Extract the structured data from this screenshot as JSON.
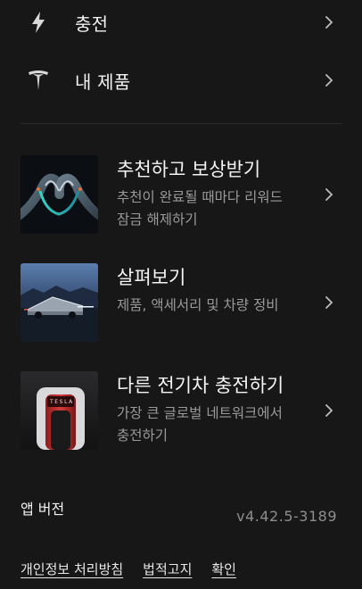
{
  "menu": {
    "charging": {
      "label": "충전",
      "icon": "lightning-bolt-icon"
    },
    "products": {
      "label": "내 제품",
      "icon": "tesla-logo-icon"
    }
  },
  "cards": [
    {
      "title": "추천하고 보상받기",
      "description": "추천이 완료될 때마다 리워드 잠금 해제하기",
      "thumbnail": "heart-hands-illustration"
    },
    {
      "title": "살펴보기",
      "description": "제품, 액세서리 및 차량 정비",
      "thumbnail": "cybertruck-photo"
    },
    {
      "title": "다른 전기차 충전하기",
      "description": "가장 큰 글로벌 네트워크에서 충전하기",
      "thumbnail": "supercharger-photo",
      "badge": "TESLA"
    }
  ],
  "app_version": {
    "label": "앱 버전",
    "value": "v4.42.5-3189"
  },
  "footer": {
    "privacy": "개인정보 처리방침",
    "legal": "법적고지",
    "confirm": "확인"
  },
  "colors": {
    "background": "#171717",
    "text_primary": "#f2f2f2",
    "text_secondary": "#9a9a9a"
  }
}
